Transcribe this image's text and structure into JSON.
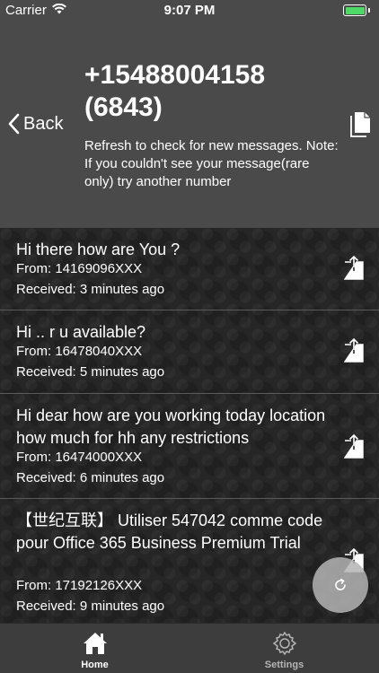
{
  "status_bar": {
    "carrier": "Carrier",
    "time": "9:07 PM"
  },
  "header": {
    "back_label": "Back",
    "phone_number": "+15488004158 (6843)",
    "note": "Refresh to check for new messages. Note: If you couldn't see your message(rare only) try another number"
  },
  "messages": [
    {
      "text": "Hi there how are You ?",
      "from": "From: 14169096XXX",
      "received": "Received: 3 minutes ago"
    },
    {
      "text": "Hi .. r u available?",
      "from": "From: 16478040XXX",
      "received": "Received: 5 minutes ago"
    },
    {
      "text": "Hi dear how are you working today location how much for hh any restrictions",
      "from": "From: 16474000XXX",
      "received": "Received: 6 minutes ago"
    },
    {
      "text": "【世纪互联】 Utiliser 547042 comme code pour Office 365 Business Premium Trial",
      "from": "From: 17192126XXX",
      "received": "Received: 9 minutes ago"
    }
  ],
  "tabs": [
    {
      "label": "Home",
      "color": "#ffffff"
    },
    {
      "label": "Settings",
      "color": "#b5b5b5"
    }
  ],
  "colors": {
    "header_bg": "#4a4a4a",
    "battery": "#4cd964",
    "tabbar_bg": "#3d3d3d"
  }
}
